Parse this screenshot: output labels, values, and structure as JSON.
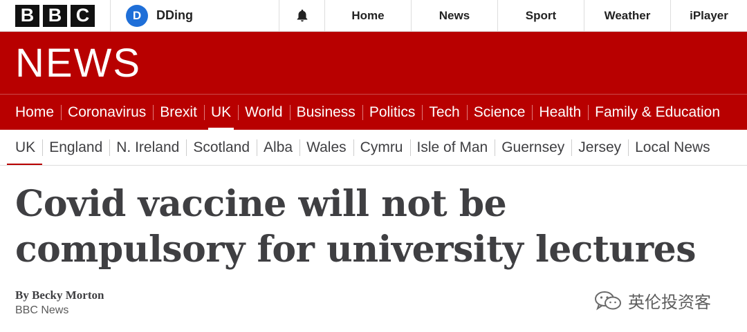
{
  "header": {
    "logo_letters": [
      "B",
      "B",
      "C"
    ],
    "account": {
      "avatar_letter": "D",
      "name": "DDing"
    },
    "nav": [
      "Home",
      "News",
      "Sport",
      "Weather",
      "iPlayer"
    ]
  },
  "banner": {
    "title": "NEWS"
  },
  "primary_nav": {
    "items": [
      "Home",
      "Coronavirus",
      "Brexit",
      "UK",
      "World",
      "Business",
      "Politics",
      "Tech",
      "Science",
      "Health",
      "Family & Education"
    ],
    "active": "UK"
  },
  "secondary_nav": {
    "items": [
      "UK",
      "England",
      "N. Ireland",
      "Scotland",
      "Alba",
      "Wales",
      "Cymru",
      "Isle of Man",
      "Guernsey",
      "Jersey",
      "Local News"
    ],
    "active": "UK"
  },
  "article": {
    "headline_line1": "Covid vaccine will not be",
    "headline_line2": "compulsory for university lectures",
    "author": "By Becky Morton",
    "source": "BBC News"
  },
  "watermark": {
    "text": "英伦投资客",
    "icon": "wechat-icon"
  },
  "colors": {
    "brand_red": "#b80000",
    "avatar_blue": "#1f6fd8",
    "headline": "#3f3f42"
  }
}
